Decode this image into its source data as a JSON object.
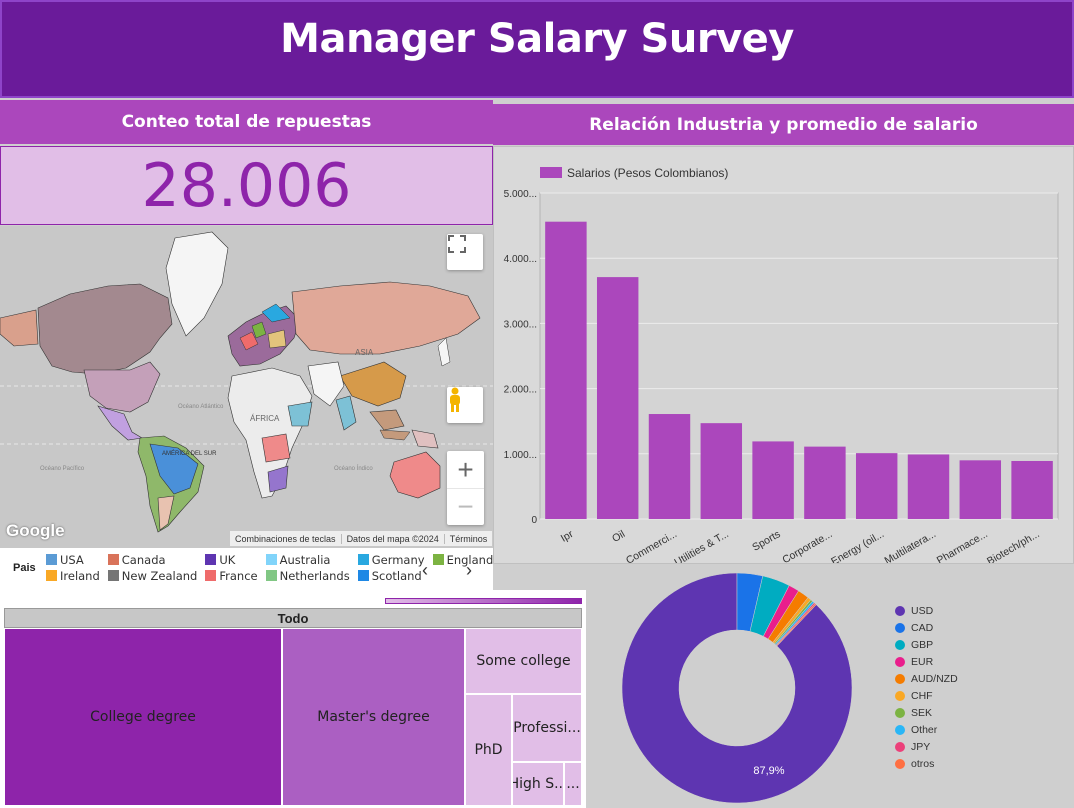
{
  "header": {
    "title": "Manager Salary Survey"
  },
  "kpi": {
    "title": "Conteo total de repuestas",
    "value": "28.006"
  },
  "bar_section": {
    "title": "Relación Industria y promedio de salario"
  },
  "map": {
    "labels": {
      "asia": "ASIA",
      "africa": "ÁFRICA",
      "america_sur": "AMÉRICA DEL SUR",
      "oceano_atlantico": "Océano Atlántico",
      "oceano_pacifico": "Océano Pacífico",
      "oceano_indico": "Océano Índico"
    },
    "google": "Google",
    "footer": [
      "Combinaciones de teclas",
      "Datos del mapa ©2024",
      "Términos"
    ],
    "icons": [
      "fullscreen-icon",
      "pegman-icon",
      "zoom-in-icon",
      "zoom-out-icon"
    ]
  },
  "legend": {
    "title": "Pais",
    "items": [
      {
        "label": "USA",
        "color": "#5b9bd5"
      },
      {
        "label": "Canada",
        "color": "#d9735a"
      },
      {
        "label": "UK",
        "color": "#5e35b1"
      },
      {
        "label": "Australia",
        "color": "#81d4fa"
      },
      {
        "label": "Germany",
        "color": "#29a8e0"
      },
      {
        "label": "England",
        "color": "#7cb342"
      },
      {
        "label": "Ireland",
        "color": "#f9a825"
      },
      {
        "label": "New Zealand",
        "color": "#757575"
      },
      {
        "label": "France",
        "color": "#ef6b6b"
      },
      {
        "label": "Netherlands",
        "color": "#81c784"
      },
      {
        "label": "Scotland",
        "color": "#1e88e5"
      }
    ],
    "prev": "‹",
    "next": "›"
  },
  "treemap": {
    "header": "Todo",
    "cells": [
      {
        "label": "College degree",
        "color": "#8e24aa"
      },
      {
        "label": "Master's degree",
        "color": "#ab5fc2"
      },
      {
        "label": "Some college",
        "color": "#e1bee7"
      },
      {
        "label": "PhD",
        "color": "#e1bee7"
      },
      {
        "label": "Professi...",
        "color": "#e1bee7"
      },
      {
        "label": "High S...",
        "color": "#e1bee7"
      },
      {
        "label": "...",
        "color": "#e1bee7"
      }
    ]
  },
  "chart_data": [
    {
      "type": "bar",
      "title": "",
      "series": [
        {
          "name": "Salarios (Pesos Colombianos)",
          "color": "#ab47bc",
          "values": [
            4560,
            3710,
            1610,
            1470,
            1190,
            1110,
            1010,
            990,
            900,
            890
          ]
        }
      ],
      "categories": [
        "Ipr",
        "Oil",
        "Commerci...",
        "Utilities & T...",
        "Sports",
        "Corporate...",
        "Energy (oil...",
        "Multilatera...",
        "Pharmace...",
        "Biotech/ph..."
      ],
      "ylim": [
        0,
        5000
      ],
      "yticks": [
        "0",
        "1.000...",
        "2.000...",
        "3.000...",
        "4.000...",
        "5.000..."
      ],
      "grid": true,
      "legend": "top-left"
    },
    {
      "type": "pie",
      "donut": true,
      "slices": [
        {
          "label": "USD",
          "value": 87.9,
          "color": "#5e35b1"
        },
        {
          "label": "CAD",
          "value": 3.6,
          "color": "#1a73e8"
        },
        {
          "label": "GBP",
          "value": 3.9,
          "color": "#00acc1"
        },
        {
          "label": "EUR",
          "value": 1.5,
          "color": "#e91e8c"
        },
        {
          "label": "AUD/NZD",
          "value": 1.6,
          "color": "#f57c00"
        },
        {
          "label": "CHF",
          "value": 0.5,
          "color": "#f9a825"
        },
        {
          "label": "SEK",
          "value": 0.3,
          "color": "#7cb342"
        },
        {
          "label": "Other",
          "value": 0.3,
          "color": "#29b6f6"
        },
        {
          "label": "JPY",
          "value": 0.2,
          "color": "#ec407a"
        },
        {
          "label": "otros",
          "value": 0.2,
          "color": "#ff7043"
        }
      ],
      "data_label": "87,9%",
      "legend": "right"
    }
  ]
}
